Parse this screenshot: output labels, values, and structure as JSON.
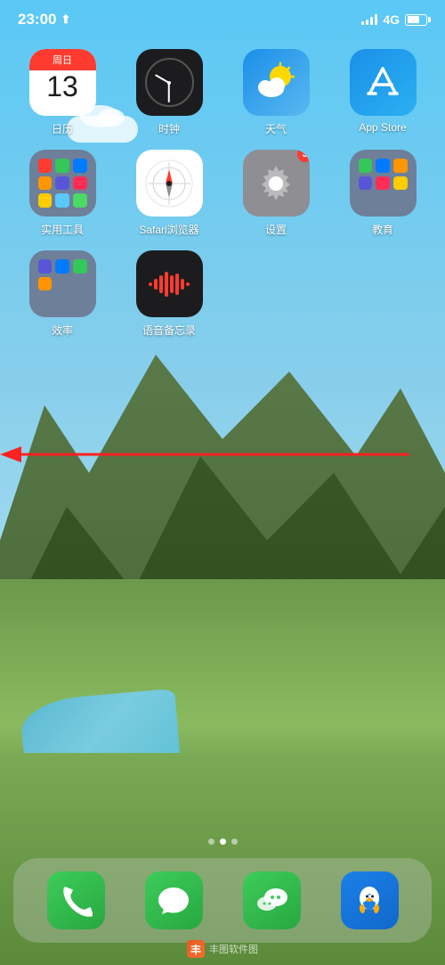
{
  "statusBar": {
    "time": "23:00",
    "networkType": "4G",
    "locationIcon": "◀"
  },
  "apps": [
    {
      "id": "calendar",
      "label": "日历",
      "type": "calendar",
      "dayName": "周日",
      "date": "13",
      "badge": null
    },
    {
      "id": "clock",
      "label": "时钟",
      "type": "clock",
      "badge": null
    },
    {
      "id": "weather",
      "label": "天气",
      "type": "weather",
      "badge": null
    },
    {
      "id": "appstore",
      "label": "App Store",
      "type": "appstore",
      "badge": null
    },
    {
      "id": "utility",
      "label": "实用工具",
      "type": "utility",
      "badge": null
    },
    {
      "id": "safari",
      "label": "Safari浏览器",
      "type": "safari",
      "badge": null
    },
    {
      "id": "settings",
      "label": "设置",
      "type": "settings",
      "badge": "3"
    },
    {
      "id": "education",
      "label": "教育",
      "type": "education",
      "badge": null
    },
    {
      "id": "efficiency",
      "label": "效率",
      "type": "efficiency",
      "badge": null
    },
    {
      "id": "voicememo",
      "label": "语音备忘录",
      "type": "voicememo",
      "badge": null
    }
  ],
  "dock": [
    {
      "id": "phone",
      "label": "电话",
      "type": "phone"
    },
    {
      "id": "messages",
      "label": "信息",
      "type": "messages"
    },
    {
      "id": "wechat",
      "label": "微信",
      "type": "wechat"
    },
    {
      "id": "qq",
      "label": "QQ",
      "type": "qq"
    }
  ],
  "pageDots": {
    "total": 3,
    "active": 1
  },
  "annotation": {
    "arrowText": "",
    "direction": "left"
  },
  "watermark": {
    "text": "丰图软件图"
  }
}
